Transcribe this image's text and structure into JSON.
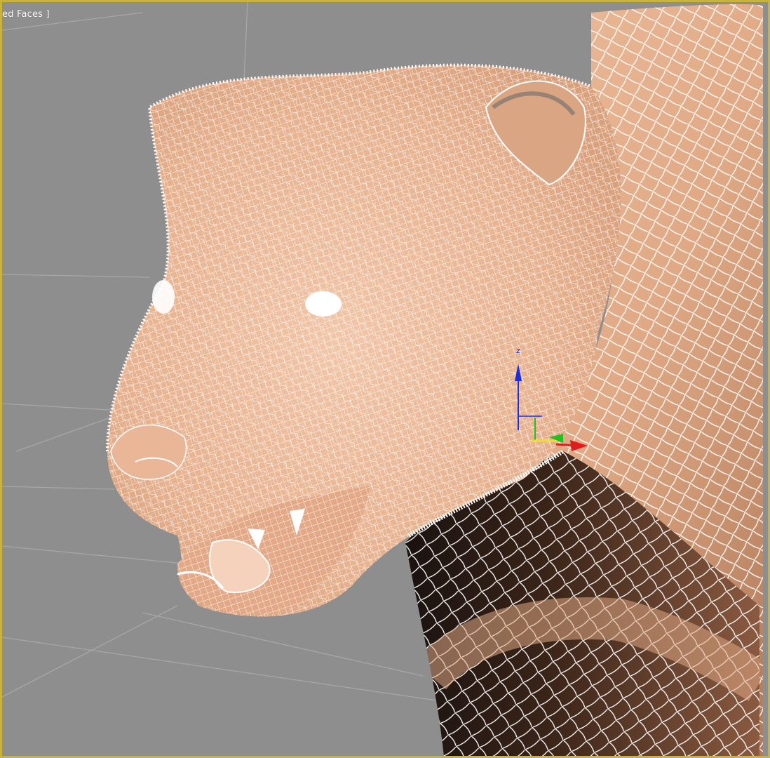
{
  "viewport": {
    "label": "ed Faces ]",
    "active_border_color": "#c8b43a",
    "background_color": "#8e8e8e",
    "grid_color": "#a9a9a9",
    "skin_color": "#e8b796",
    "wire_color": "#ffffff"
  },
  "gizmo": {
    "z_label": "z",
    "z_color": "#1c2fe0",
    "x_color": "#e01c1c",
    "y_color": "#22c022",
    "plane_color": "#f0e020"
  }
}
